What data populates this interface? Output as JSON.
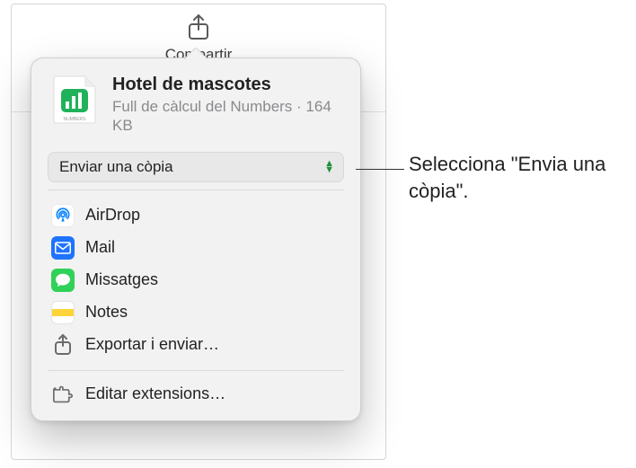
{
  "toolbar": {
    "share_label": "Compartir"
  },
  "file": {
    "title": "Hotel de mascotes",
    "subtitle": "Full de càlcul del Numbers · 164 KB",
    "icon_name": "numbers-document-icon",
    "icon_label": "NUMBERS"
  },
  "mode": {
    "selected": "Enviar una còpia"
  },
  "share_options": [
    {
      "id": "airdrop",
      "label": "AirDrop",
      "icon": "airdrop-icon"
    },
    {
      "id": "mail",
      "label": "Mail",
      "icon": "mail-icon"
    },
    {
      "id": "messages",
      "label": "Missatges",
      "icon": "messages-icon"
    },
    {
      "id": "notes",
      "label": "Notes",
      "icon": "notes-icon"
    },
    {
      "id": "export",
      "label": "Exportar i enviar…",
      "icon": "export-icon"
    }
  ],
  "extensions": {
    "label": "Editar extensions…"
  },
  "callout": {
    "text": "Selecciona \"Envia una còpia\"."
  }
}
